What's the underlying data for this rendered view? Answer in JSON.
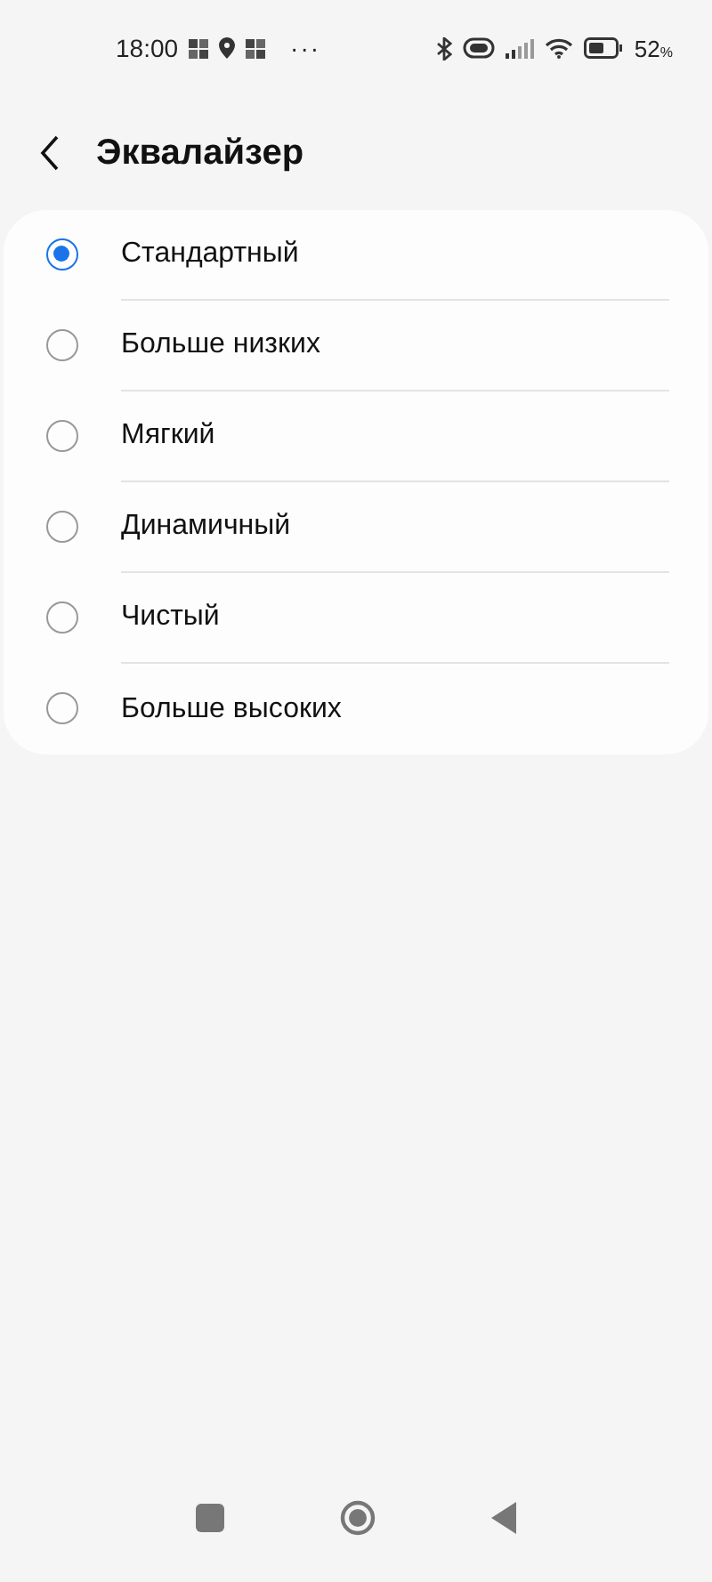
{
  "status_bar": {
    "time": "18:00",
    "more": "···",
    "battery": "52",
    "battery_unit": "%"
  },
  "header": {
    "title": "Эквалайзер"
  },
  "options": [
    {
      "label": "Стандартный",
      "selected": true
    },
    {
      "label": "Больше низких",
      "selected": false
    },
    {
      "label": "Мягкий",
      "selected": false
    },
    {
      "label": "Динамичный",
      "selected": false
    },
    {
      "label": "Чистый",
      "selected": false
    },
    {
      "label": "Больше высоких",
      "selected": false
    }
  ]
}
